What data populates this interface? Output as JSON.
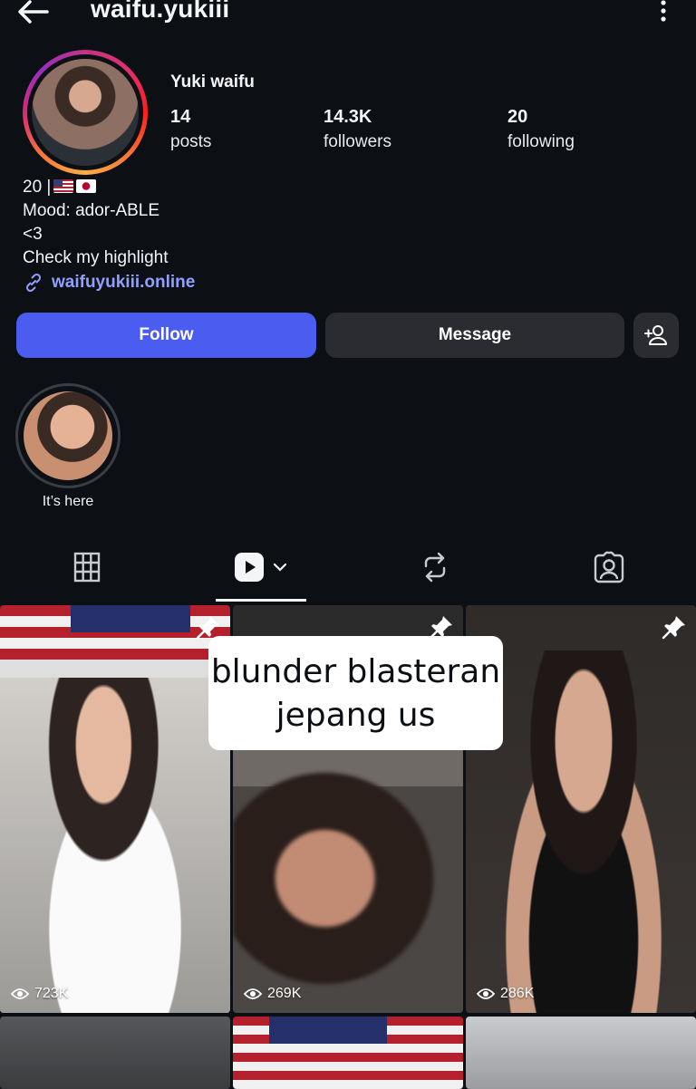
{
  "header": {
    "handle": "waifu.yukiii",
    "back_icon": "back-arrow-icon",
    "more_icon": "more-vertical-icon"
  },
  "profile": {
    "display_name": "Yuki waifu",
    "stats": [
      {
        "value": "14",
        "label": "posts"
      },
      {
        "value": "14.3K",
        "label": "followers"
      },
      {
        "value": "20",
        "label": "following"
      }
    ],
    "bio": {
      "line1": "20 |",
      "line2": "Mood: ador-ABLE",
      "line3": "<3",
      "line4": "Check my highlight"
    },
    "link": "waifuyukiii.online"
  },
  "actions": {
    "follow": "Follow",
    "message": "Message"
  },
  "highlights": [
    {
      "label": "It’s here"
    }
  ],
  "tabs": [
    "grid",
    "reels",
    "reposts",
    "tagged"
  ],
  "reels": [
    {
      "views": "723K",
      "pinned": true
    },
    {
      "views": "269K",
      "pinned": true,
      "caption_line1": "blunder blasteran",
      "caption_line2": "jepang us"
    },
    {
      "views": "286K",
      "pinned": true
    }
  ],
  "colors": {
    "accent": "#4b5cf0",
    "link": "#8fa0ff",
    "background": "#0c0f14",
    "button_dark": "#2a2c31"
  }
}
